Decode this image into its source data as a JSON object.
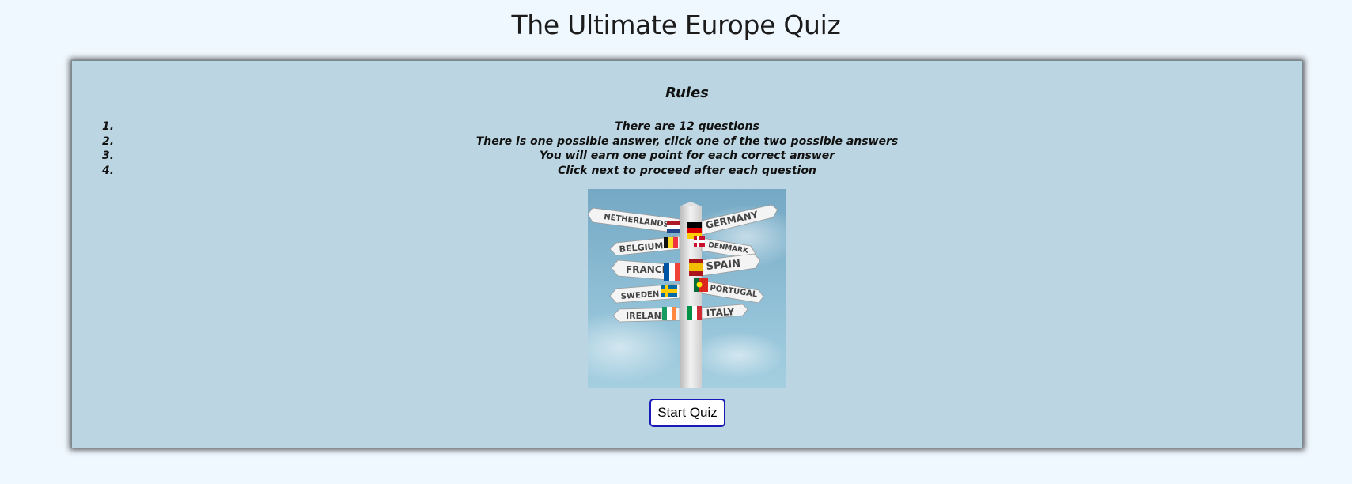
{
  "page": {
    "title": "The Ultimate Europe Quiz"
  },
  "rules": {
    "heading": "Rules",
    "items": [
      {
        "number": "1.",
        "text": "There are 12 questions"
      },
      {
        "number": "2.",
        "text": "There is one possible answer, click one of the two possible answers"
      },
      {
        "number": "3.",
        "text": "You will earn one point for each correct answer"
      },
      {
        "number": "4.",
        "text": "Click next to proceed after each question"
      }
    ]
  },
  "image": {
    "signs_left": [
      "NETHERLANDS",
      "BELGIUM",
      "FRANCE",
      "SWEDEN",
      "IRELAND"
    ],
    "signs_right": [
      "GERMANY",
      "DENMARK",
      "SPAIN",
      "PORTUGAL",
      "ITALY"
    ]
  },
  "actions": {
    "start_label": "Start Quiz"
  },
  "colors": {
    "page_background": "#f0f8ff",
    "card_background": "#bbd6e2",
    "button_border": "#1a1ab8"
  }
}
